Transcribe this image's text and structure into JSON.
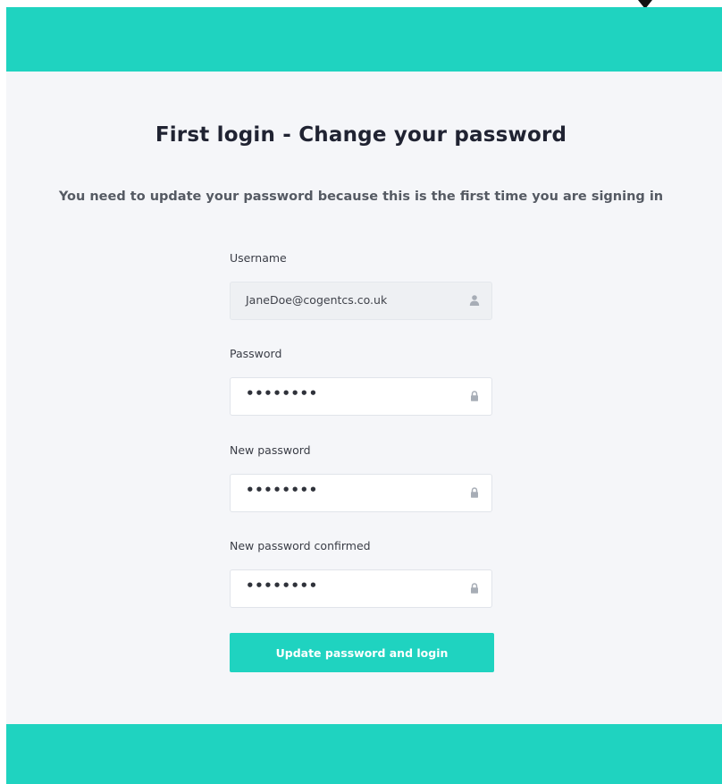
{
  "colors": {
    "brand_teal": "#1fd3c0",
    "page_background": "#f5f6f9",
    "title_text": "#202332",
    "subtitle_text": "#555a63"
  },
  "header": {
    "title": "First login - Change your password",
    "subtitle": "You need to update your password because this is the first time you are signing in"
  },
  "form": {
    "username": {
      "label": "Username",
      "value": "JaneDoe@cogentcs.co.uk",
      "icon": "user-icon"
    },
    "password": {
      "label": "Password",
      "masked_value": "••••••••",
      "icon": "lock-icon"
    },
    "new_password": {
      "label": "New password",
      "masked_value": "••••••••",
      "icon": "lock-icon"
    },
    "new_password_confirmed": {
      "label": "New password confirmed",
      "masked_value": "••••••••",
      "icon": "lock-icon"
    },
    "submit_label": "Update password and login"
  }
}
